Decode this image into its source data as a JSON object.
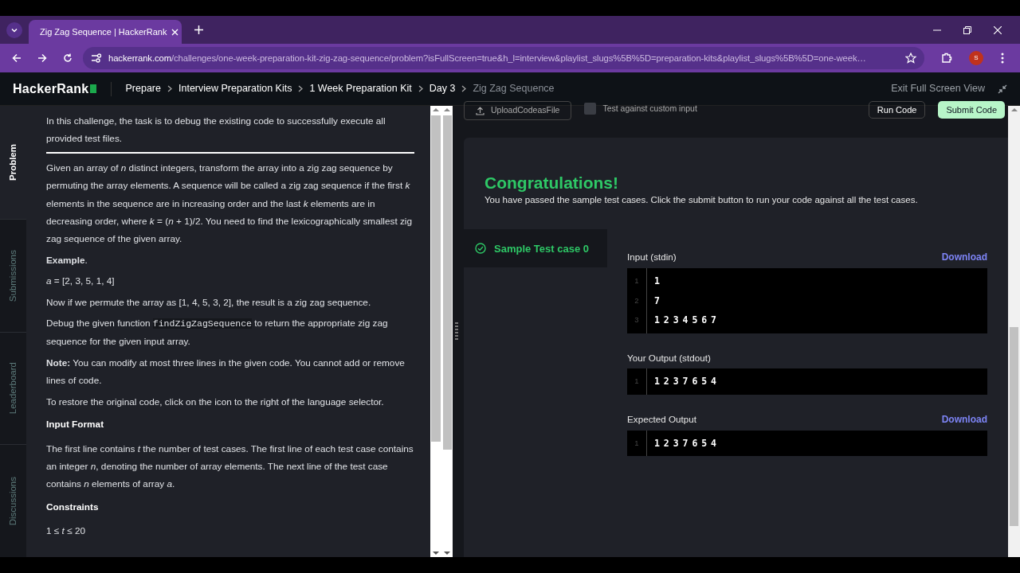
{
  "browser": {
    "tab_title": "Zig Zag Sequence | HackerRank",
    "url_domain": "hackerrank.com",
    "url_rest": "/challenges/one-week-preparation-kit-zig-zag-sequence/problem?isFullScreen=true&h_l=interview&playlist_slugs%5B%5D=preparation-kits&playlist_slugs%5B%5D=one-week…",
    "profile_initial": "S"
  },
  "header": {
    "logo": "HackerRank",
    "breadcrumbs": [
      {
        "label": "Prepare",
        "current": false
      },
      {
        "label": "Interview Preparation Kits",
        "current": false
      },
      {
        "label": "1 Week Preparation Kit",
        "current": false
      },
      {
        "label": "Day 3",
        "current": false
      },
      {
        "label": "Zig Zag Sequence",
        "current": true
      }
    ],
    "exit_label": "Exit Full Screen View"
  },
  "side_tabs": [
    {
      "label": "Problem",
      "selected": true
    },
    {
      "label": "Submissions",
      "selected": false
    },
    {
      "label": "Leaderboard",
      "selected": false
    },
    {
      "label": "Discussions",
      "selected": false
    }
  ],
  "problem": [
    {
      "kind": "para",
      "text": "In this challenge, the task is to debug the existing code to successfully execute all provided test files."
    },
    {
      "kind": "rule"
    },
    {
      "kind": "para",
      "text": "Given an array of *n* distinct integers, transform the array into a zig zag sequence by permuting the array elements. A sequence will be called a zig zag sequence if the first *k* elements in the sequence are in increasing order and the last *k* elements are in decreasing order, where *k* = (*n* + 1)/2. You need to find the lexicographically smallest zig zag sequence of the given array."
    },
    {
      "kind": "para",
      "text": "**Example**."
    },
    {
      "kind": "para",
      "text": "*a* = [2, 3, 5, 1, 4]"
    },
    {
      "kind": "para",
      "text": "Now if we permute the array as [1, 4, 5, 3, 2], the result is a zig zag sequence."
    },
    {
      "kind": "code_para",
      "parts": [
        {
          "kind": "text",
          "text": "Debug the given function "
        },
        {
          "kind": "code",
          "text": "findZigZagSequence"
        },
        {
          "kind": "text",
          "text": " to return the appropriate zig zag sequence for the given input array."
        }
      ]
    },
    {
      "kind": "para",
      "text": "**Note:** You can modify at most three lines in the given code. You cannot add or remove lines of code."
    },
    {
      "kind": "para",
      "text": "To restore the original code, click on the icon to the right of the language selector."
    },
    {
      "kind": "heading",
      "text": "Input Format"
    },
    {
      "kind": "para",
      "text": "The first line contains *t* the number of test cases. The first line of each test case contains an integer *n*, denoting the number of array elements. The next line of the test case contains *n* elements of array *a*."
    },
    {
      "kind": "heading",
      "text": "Constraints"
    },
    {
      "kind": "para",
      "text": "1 ≤ *t* ≤ 20"
    }
  ],
  "toolbar": {
    "upload_label": "UploadCodeasFile",
    "custom_input_label": "Test against custom input",
    "custom_input_checked": false,
    "run_label": "Run Code",
    "submit_label": "Submit Code"
  },
  "result": {
    "title": "Congratulations!",
    "message": "You have passed the sample test cases. Click the submit button to run your code against all the test cases.",
    "test_cases": [
      {
        "label": "Sample Test case 0",
        "selected": true,
        "passed": true
      }
    ],
    "sections": [
      {
        "title": "Input (stdin)",
        "download": "Download",
        "lines": [
          {
            "number": "1",
            "text": "1"
          },
          {
            "number": "2",
            "text": "7"
          },
          {
            "number": "3",
            "text": "1 2 3 4 5 6 7"
          }
        ]
      },
      {
        "title": "Your Output (stdout)",
        "lines": [
          {
            "number": "1",
            "text": "1 2 3 7 6 5 4"
          }
        ]
      },
      {
        "title": "Expected Output",
        "download": "Download",
        "lines": [
          {
            "number": "1",
            "text": "1 2 3 7 6 5 4"
          }
        ]
      }
    ]
  }
}
